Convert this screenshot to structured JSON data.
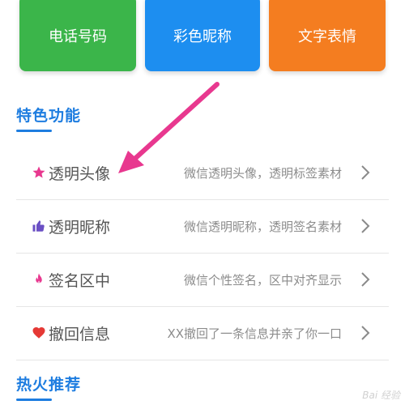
{
  "tiles": [
    {
      "label": "电话号码",
      "color": "#3bb54a"
    },
    {
      "label": "彩色昵称",
      "color": "#1d8ef0"
    },
    {
      "label": "文字表情",
      "color": "#f47d20"
    }
  ],
  "sections": {
    "featured_title": "特色功能",
    "hot_title": "热火推荐"
  },
  "features": [
    {
      "label": "透明头像",
      "desc": "微信透明头像，透明标签素材",
      "icon": "star-icon",
      "icon_color": "#e8388f"
    },
    {
      "label": "透明昵称",
      "desc": "微信透明昵称，透明签名素材",
      "icon": "thumbs-up-icon",
      "icon_color": "#6a4fc4"
    },
    {
      "label": "签名区中",
      "desc": "微信个性签名，区中对齐显示",
      "icon": "flame-icon",
      "icon_color": "#e8388f"
    },
    {
      "label": "撤回信息",
      "desc": "XX撤回了一条信息并亲了你一口",
      "icon": "heart-icon",
      "icon_color": "#e53935"
    }
  ],
  "annotation": {
    "arrow_color": "#e8388f"
  },
  "watermark": {
    "text": "Bai 经验"
  }
}
